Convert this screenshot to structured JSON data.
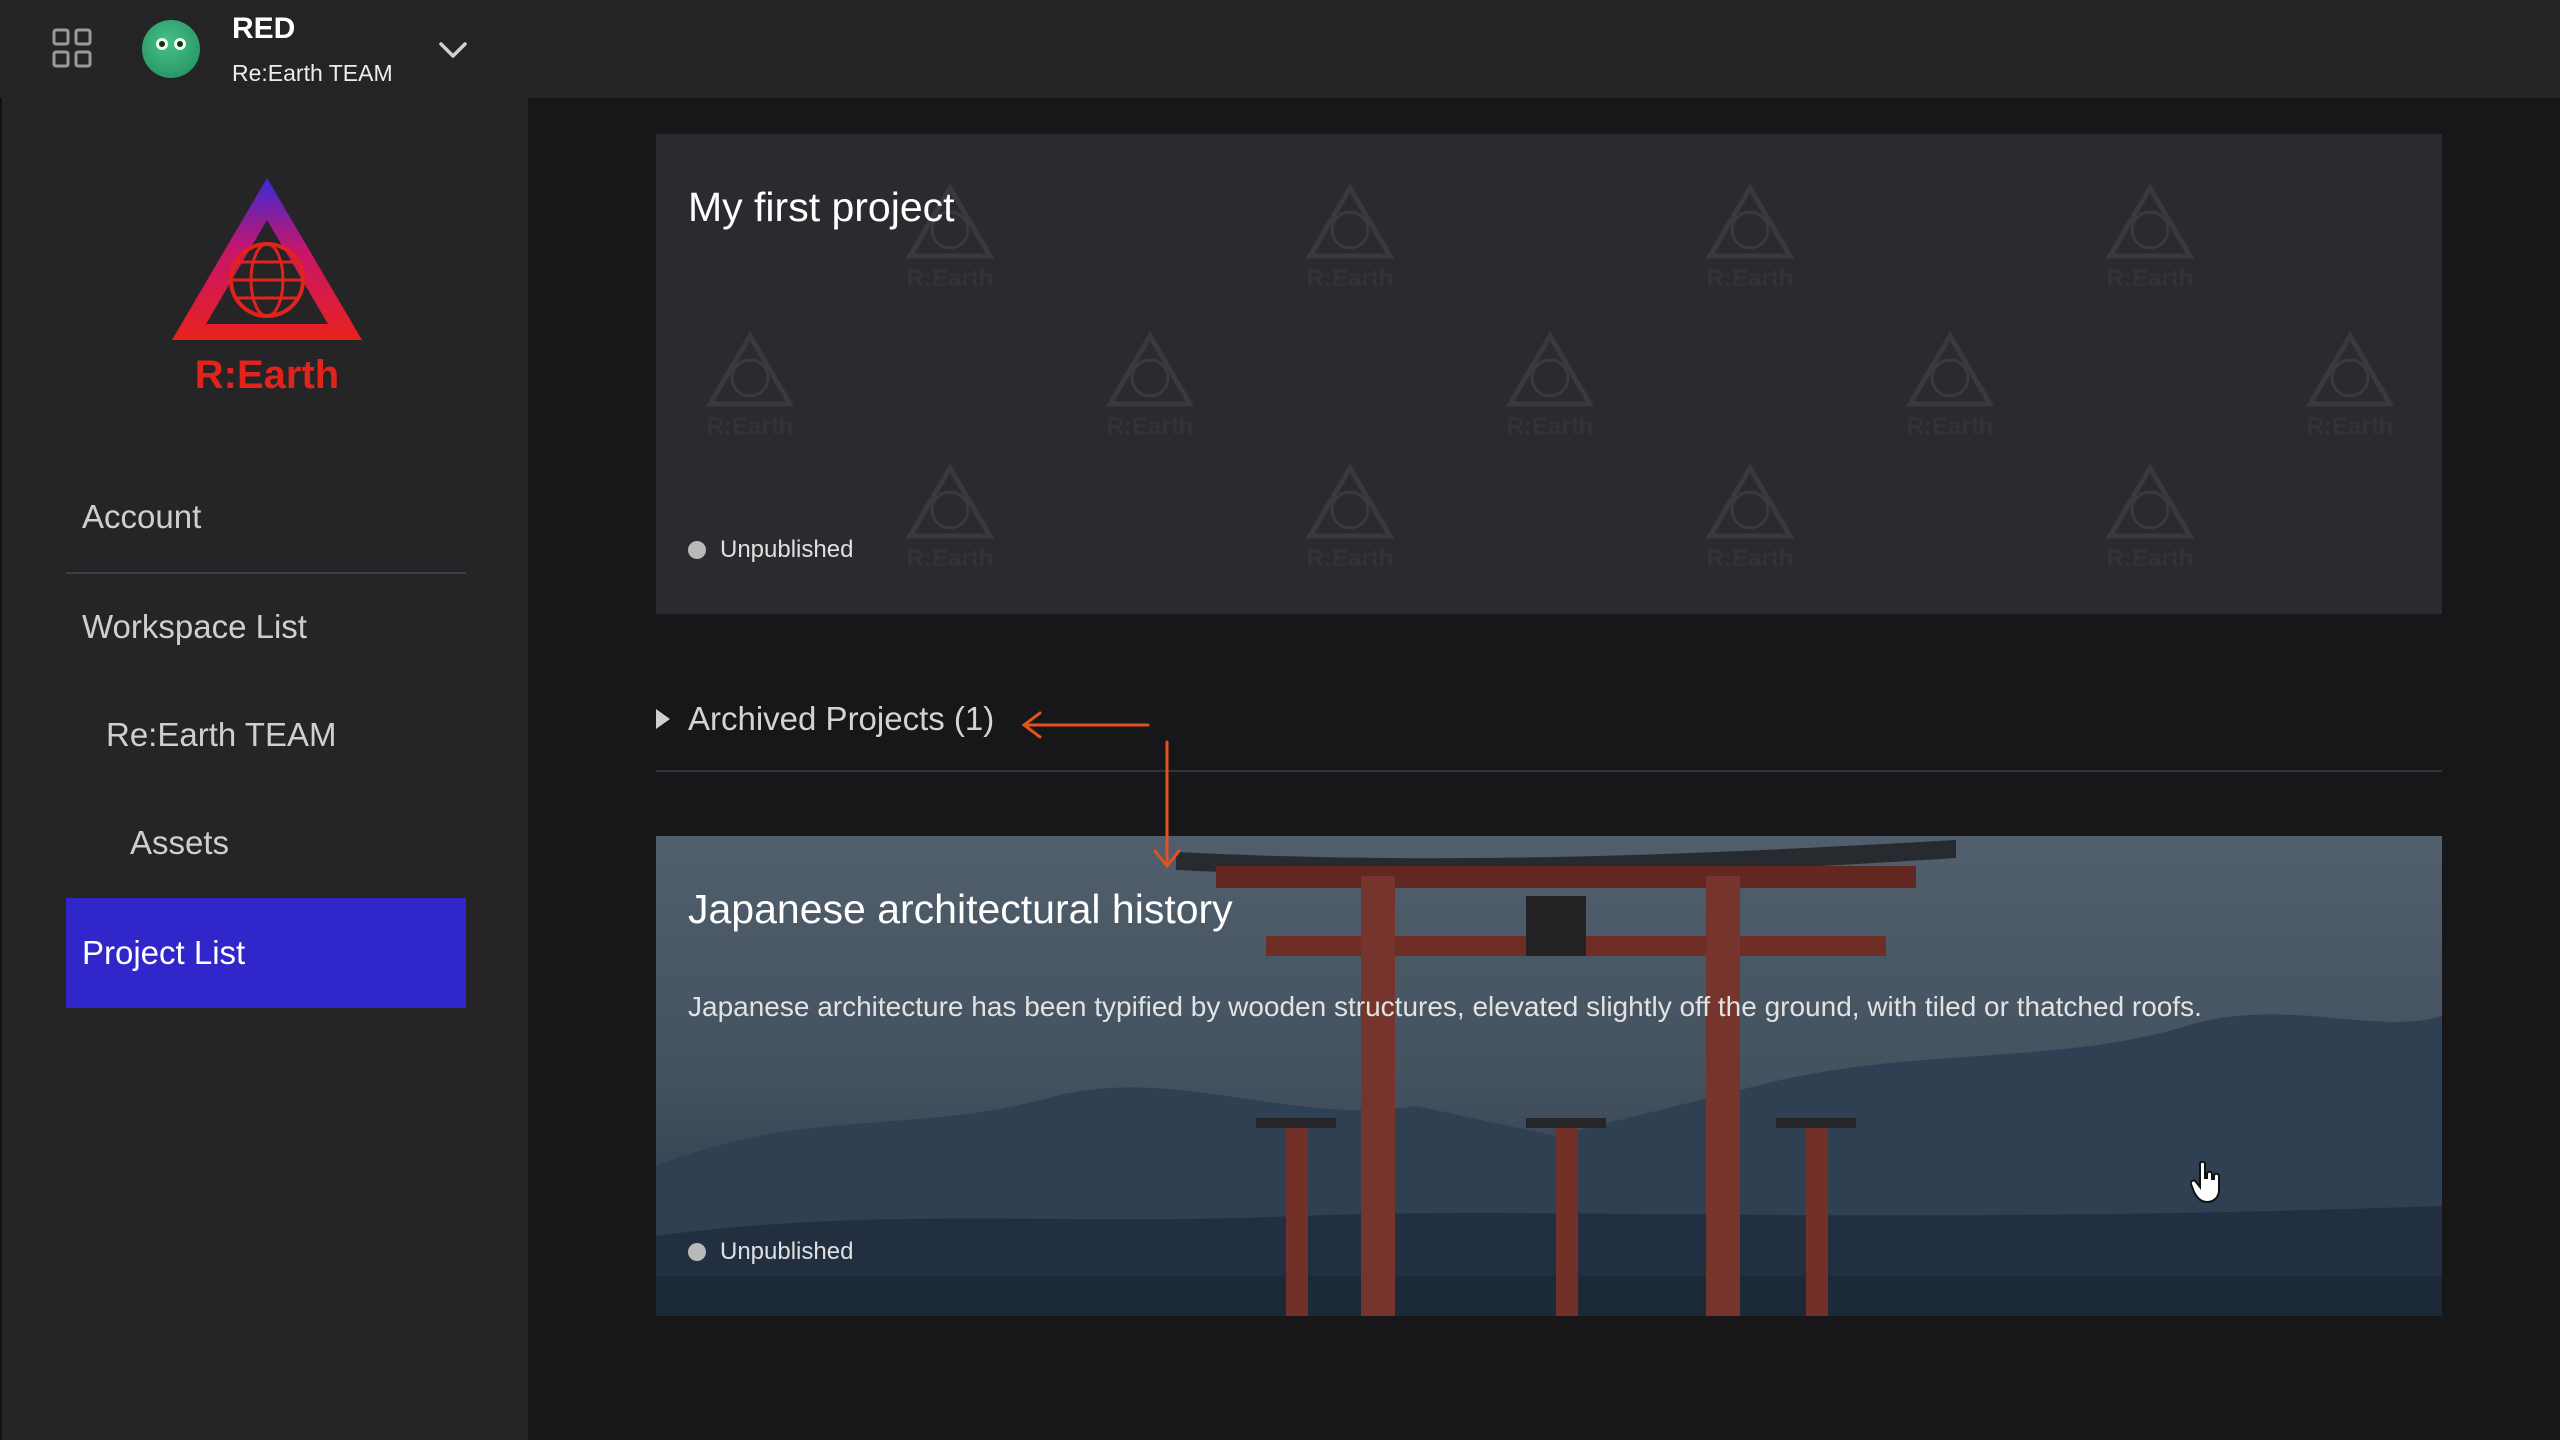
{
  "topbar": {
    "user_name": "RED",
    "team_name": "Re:Earth TEAM"
  },
  "sidebar": {
    "logo_text": "R:Earth",
    "items": [
      {
        "label": "Account"
      },
      {
        "label": "Workspace List"
      },
      {
        "label": "Re:Earth TEAM"
      },
      {
        "label": "Assets"
      },
      {
        "label": "Project List"
      }
    ],
    "active_label": "Project List"
  },
  "projects": [
    {
      "title": "My first project",
      "status": "Unpublished"
    },
    {
      "title": "Japanese architectural history",
      "description": "Japanese architecture has been typified by wooden structures, elevated slightly off the ground, with tiled or thatched roofs.",
      "status": "Unpublished"
    }
  ],
  "archived": {
    "label": "Archived Projects (1)"
  },
  "colors": {
    "accent_active": "#3126c9",
    "annotation_arrow": "#e0531f",
    "logo_red": "#e0241c"
  },
  "icons": [
    "grid-apps-icon",
    "chevron-down-icon",
    "caret-right-icon",
    "hand-cursor-icon"
  ]
}
